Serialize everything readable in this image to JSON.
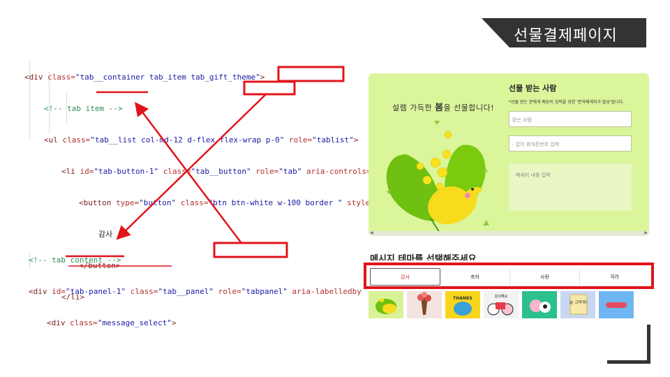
{
  "slide": {
    "title": "선물결제페이지"
  },
  "code_top": {
    "line1": {
      "open": "<div ",
      "a1": "class=",
      "v1": "\"tab__container tab_item tab_gift_theme\"",
      "close": ">"
    },
    "line2": {
      "comment": "<!-- tab item -->"
    },
    "line3": {
      "open": "<ul ",
      "a1": "class=",
      "v1": "\"tab__list col-md-12 d-flex flex-wrap p-0\"",
      "sp": " ",
      "a2": "role=",
      "v2": "\"tablist\"",
      "close": ">"
    },
    "line4": {
      "open": "<li ",
      "a1": "id=",
      "v1": "\"tab-button-1\"",
      "sp": " ",
      "a2": "class=",
      "v2": "\"tab__button\"",
      "sp2": " ",
      "a3": "role=",
      "v3": "\"tab\"",
      "a4": " aria-controls="
    },
    "line5": {
      "open": "<button ",
      "a1": "type=",
      "v1": "\"button\"",
      "sp": " ",
      "a2": "class=",
      "v2": "\"btn btn-white w-100 border \"",
      "a3": " style"
    },
    "line6": {
      "text": "감사"
    },
    "line7": {
      "close": "</button>"
    },
    "line8": {
      "close": "</li>"
    }
  },
  "code_bottom": {
    "line1": {
      "comment": "<!-- tab content -->"
    },
    "line2": {
      "open": "<div ",
      "a1": "id=",
      "v1": "\"tab-panel-1\"",
      "sp": " ",
      "a2": "class=",
      "v2": "\"tab__panel\"",
      "sp2": " ",
      "a3": "role=",
      "v3": "\"tabpanel\"",
      "a4": " aria-labelledby"
    },
    "line3": {
      "open": "<div ",
      "a1": "class=",
      "v1": "\"message_select\"",
      "close": ">"
    }
  },
  "gift": {
    "slogan_pre": "설렘 가득한 ",
    "slogan_bold": "봄",
    "slogan_post": "을 선물합니다!",
    "receiver_title": "선물 받는 사람",
    "receiver_note": "*선물 받는 분에게 배송지 입력을 위한 '문자메세지가 발송'됩니다.",
    "name_placeholder": "받는 사람",
    "phone_placeholder": "- 없이 휴대폰번호 입력",
    "message_placeholder": "메세지 내용 입력"
  },
  "theme": {
    "heading": "메시지 테마를 선택해주세요",
    "tabs": [
      "감사",
      "축하",
      "사랑",
      "격려"
    ],
    "active_tab": "감사",
    "sticker_words": {
      "thanks": "THANKS",
      "gamsa": "감사해요",
      "note": "늘 고마워!"
    }
  },
  "colors": {
    "highlight_red": "#e0141a",
    "panel_green": "#dbf59a",
    "title_bg": "#333333"
  }
}
